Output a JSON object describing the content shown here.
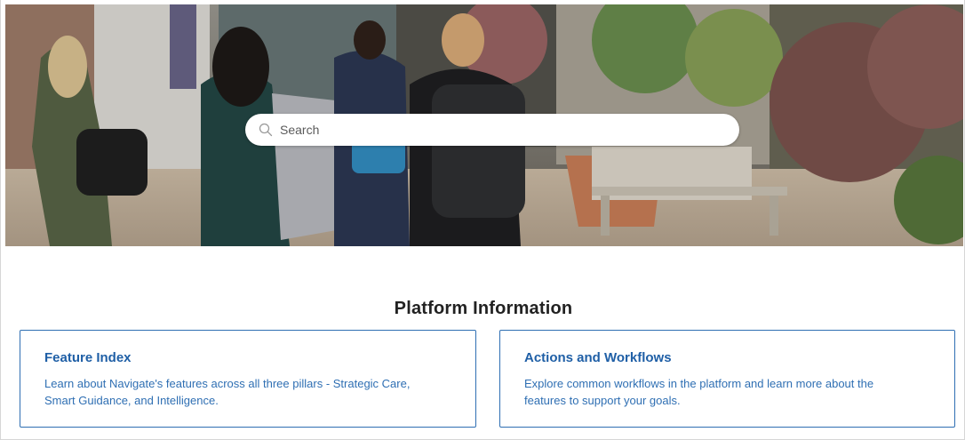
{
  "hero": {
    "search": {
      "placeholder": "Search"
    }
  },
  "section": {
    "title": "Platform Information"
  },
  "cards": [
    {
      "title": "Feature Index",
      "description": "Learn about Navigate's features across all three pillars - Strategic Care, Smart Guidance, and Intelligence."
    },
    {
      "title": "Actions and Workflows",
      "description": "Explore common workflows in the platform and learn more about the features to support your goals."
    }
  ],
  "colors": {
    "accent": "#1f5fa6",
    "card_border": "#2f6fb3",
    "title_text": "#222222"
  },
  "icons": {
    "search": "search-icon"
  }
}
